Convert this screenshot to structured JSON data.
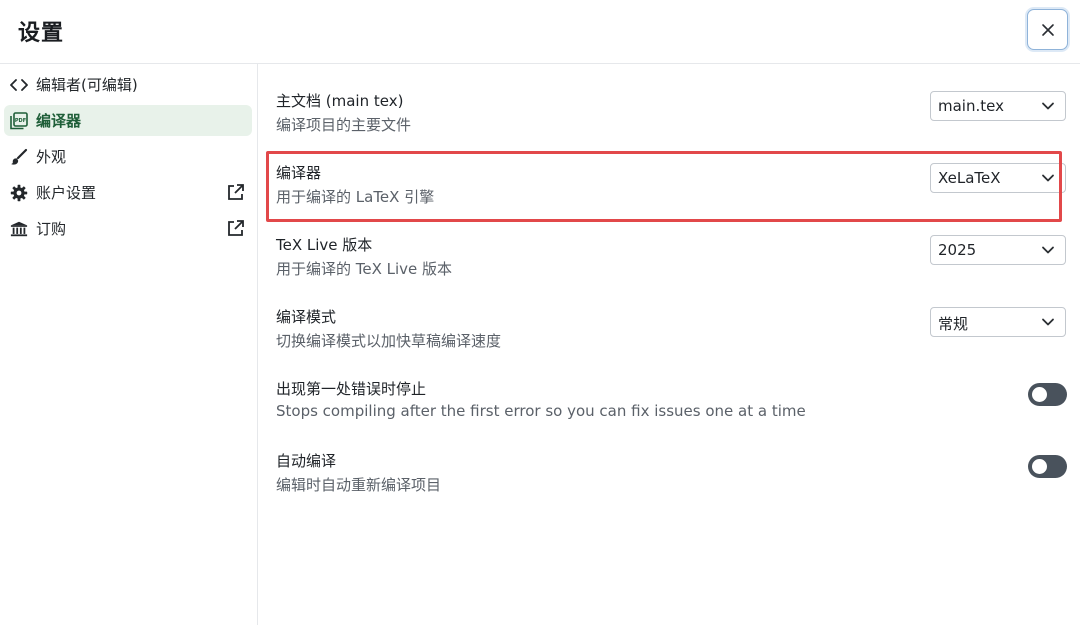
{
  "header": {
    "title": "设置",
    "close_icon": "close-icon"
  },
  "sidebar": {
    "items": [
      {
        "label": "编辑者(可编辑)",
        "icon": "code-icon",
        "active": false,
        "external": false
      },
      {
        "label": "编译器",
        "icon": "pdf-icon",
        "active": true,
        "external": false
      },
      {
        "label": "外观",
        "icon": "brush-icon",
        "active": false,
        "external": false
      },
      {
        "label": "账户设置",
        "icon": "gear-icon",
        "active": false,
        "external": true
      },
      {
        "label": "订购",
        "icon": "bank-icon",
        "active": false,
        "external": true
      }
    ]
  },
  "settings": [
    {
      "title": "主文档 (main tex)",
      "desc": "编译项目的主要文件",
      "control": "select",
      "value": "main.tex"
    },
    {
      "title": "编译器",
      "desc": "用于编译的 LaTeX 引擎",
      "control": "select",
      "value": "XeLaTeX"
    },
    {
      "title": "TeX Live 版本",
      "desc": "用于编译的 TeX Live 版本",
      "control": "select",
      "value": "2025"
    },
    {
      "title": "编译模式",
      "desc": "切换编译模式以加快草稿编译速度",
      "control": "select",
      "value": "常规"
    },
    {
      "title": "出现第一处错误时停止",
      "desc": "Stops compiling after the first error so you can fix issues one at a time",
      "control": "toggle",
      "value": "off"
    },
    {
      "title": "自动编译",
      "desc": "编辑时自动重新编译项目",
      "control": "toggle",
      "value": "off"
    }
  ],
  "colors": {
    "accent_active": "#1e5e38",
    "highlight": "#e2484a",
    "toggle_off": "#49525c"
  }
}
